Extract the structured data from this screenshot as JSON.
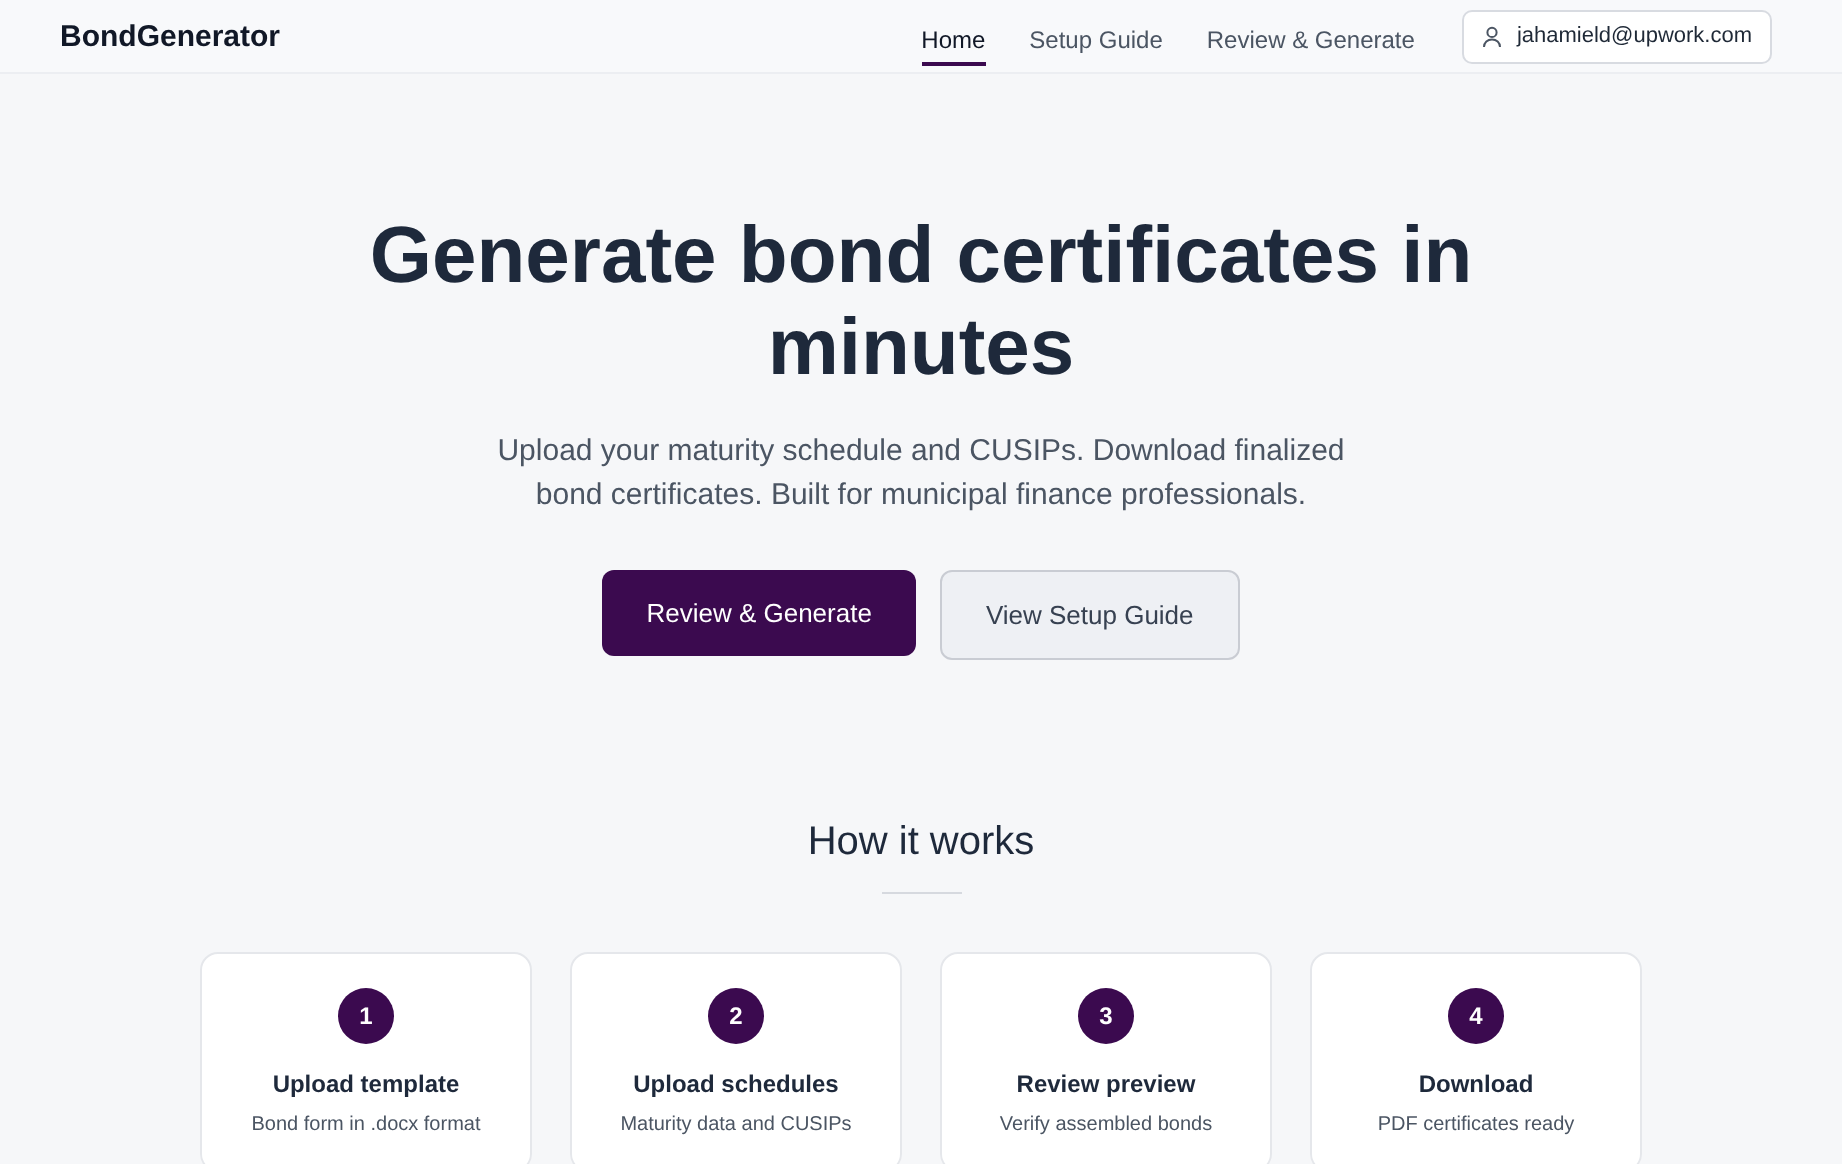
{
  "brand": "BondGenerator",
  "nav": [
    {
      "label": "Home",
      "selected": true
    },
    {
      "label": "Setup Guide",
      "selected": false
    },
    {
      "label": "Review & Generate",
      "selected": false
    }
  ],
  "user": "jahamield@upwork.com",
  "hero": {
    "title": "Generate bond certificates in minutes",
    "subtitle": "Upload your maturity schedule and CUSIPs. Download finalized bond certificates. Built for municipal finance professionals.",
    "primary": "Review & Generate",
    "secondary": "View Setup Guide"
  },
  "how": {
    "title": "How it works",
    "steps": [
      {
        "number": "1",
        "title": "Upload template",
        "desc": "Bond form in .docx format"
      },
      {
        "number": "2",
        "title": "Upload schedules",
        "desc": "Maturity data and CUSIPs"
      },
      {
        "number": "3",
        "title": "Review preview",
        "desc": "Verify assembled bonds"
      },
      {
        "number": "4",
        "title": "Download",
        "desc": "PDF certificates ready"
      }
    ]
  }
}
